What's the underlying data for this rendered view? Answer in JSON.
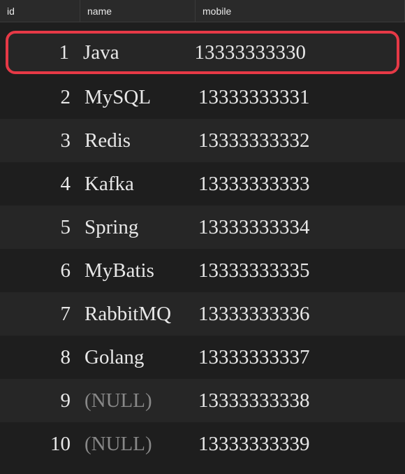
{
  "columns": {
    "id": "id",
    "name": "name",
    "mobile": "mobile"
  },
  "rows": [
    {
      "id": "1",
      "name": "Java",
      "mobile": "13333333330",
      "highlighted": true,
      "name_null": false
    },
    {
      "id": "2",
      "name": "MySQL",
      "mobile": "13333333331",
      "highlighted": false,
      "name_null": false
    },
    {
      "id": "3",
      "name": "Redis",
      "mobile": "13333333332",
      "highlighted": false,
      "name_null": false
    },
    {
      "id": "4",
      "name": "Kafka",
      "mobile": "13333333333",
      "highlighted": false,
      "name_null": false
    },
    {
      "id": "5",
      "name": "Spring",
      "mobile": "13333333334",
      "highlighted": false,
      "name_null": false
    },
    {
      "id": "6",
      "name": "MyBatis",
      "mobile": "13333333335",
      "highlighted": false,
      "name_null": false
    },
    {
      "id": "7",
      "name": "RabbitMQ",
      "mobile": "13333333336",
      "highlighted": false,
      "name_null": false
    },
    {
      "id": "8",
      "name": "Golang",
      "mobile": "13333333337",
      "highlighted": false,
      "name_null": false
    },
    {
      "id": "9",
      "name": "(NULL)",
      "mobile": "13333333338",
      "highlighted": false,
      "name_null": true
    },
    {
      "id": "10",
      "name": "(NULL)",
      "mobile": "13333333339",
      "highlighted": false,
      "name_null": true
    }
  ]
}
